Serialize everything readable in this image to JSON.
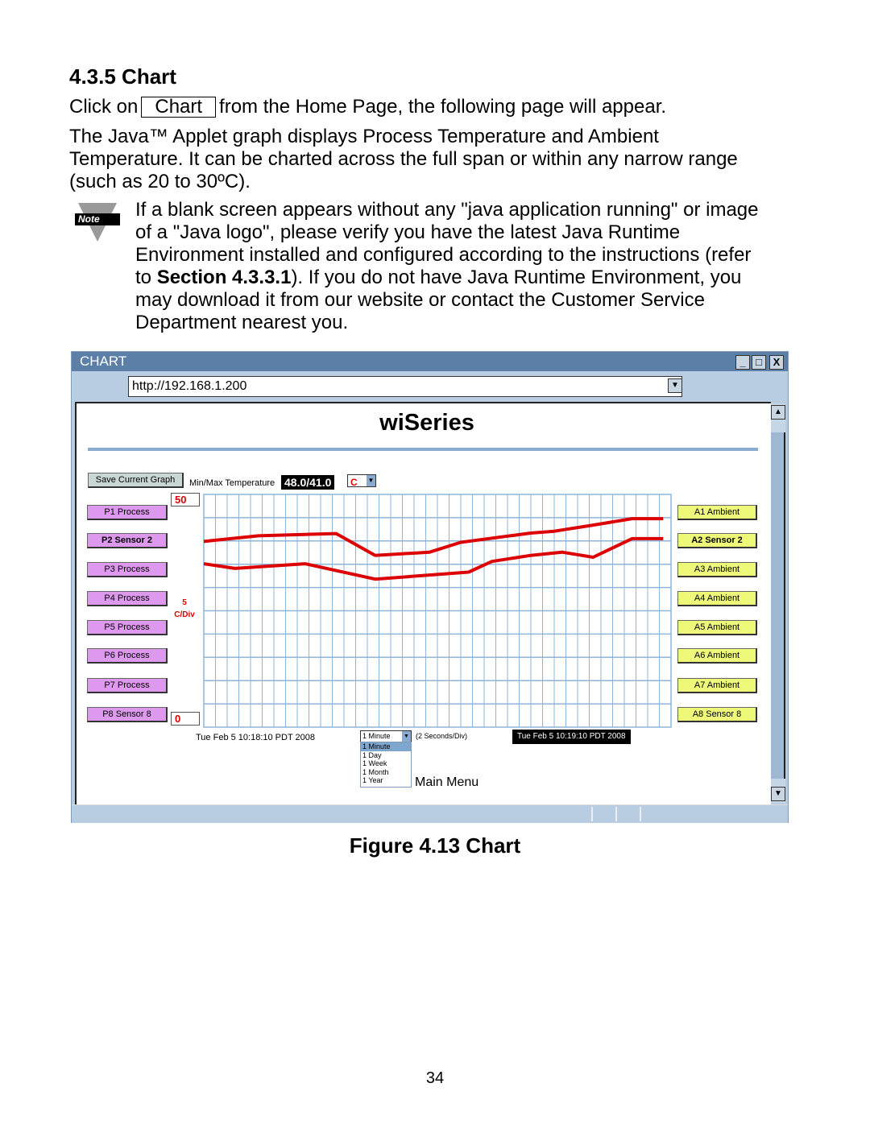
{
  "heading": "4.3.5  Chart",
  "intro": {
    "before": "Click on",
    "button": "Chart",
    "after": "from the Home Page, the following page will appear."
  },
  "para1_lines": [
    "The Java™ Applet graph displays Process Temperature and Ambient",
    "Temperature.  It can be charted across the full span or within any narrow range",
    "(such as 20 to 30ºC)."
  ],
  "note": {
    "icon_label": "Note",
    "lines": [
      "If a blank screen appears without any \"java application running\" or image",
      "of a \"Java logo\", please verify you have the latest Java Runtime",
      "Environment installed and configured according to the instructions (refer"
    ],
    "line4_pre": "to ",
    "line4_bold": "Section 4.3.3.1",
    "line4_post": ").  If you do not have Java Runtime Environment, you",
    "lines_end": [
      "may download it from our website or contact the Customer Service",
      "Department nearest you."
    ]
  },
  "window": {
    "title": "CHART",
    "address": "http://192.168.1.200",
    "controls": [
      "_",
      "□",
      "X"
    ]
  },
  "app": {
    "title": "wiSeries",
    "save_button": "Save Current Graph",
    "minmax_label": "Min/Max Temperature",
    "minmax_value": "48.0/41.0",
    "unit": "C",
    "ymax_input": "50",
    "ymin_input": "0",
    "div_value": "5",
    "div_unit": "C/Div",
    "left_buttons": [
      "P1 Process",
      "P2 Sensor 2",
      "P3 Process",
      "P4 Process",
      "P5 Process",
      "P6 Process",
      "P7 Process",
      "P8 Sensor 8"
    ],
    "right_buttons": [
      "A1 Ambient",
      "A2 Sensor 2",
      "A3 Ambient",
      "A4 Ambient",
      "A5 Ambient",
      "A6 Ambient",
      "A7 Ambient",
      "A8 Sensor 8"
    ],
    "start_time": "Tue Feb 5 10:18:10 PDT 2008",
    "end_time": "Tue Feb 5 10:19:10 PDT 2008",
    "range_select": "1 Minute",
    "range_options": [
      "1 Minute",
      "1 Day",
      "1 Week",
      "1 Month",
      "1 Year"
    ],
    "seconds_div": "(2 Seconds/Div)",
    "main_menu": "Main Menu"
  },
  "colors": {
    "line": "#dd0000",
    "grid": "#8fb6d8",
    "left_button": "#dd99ee",
    "right_button": "#eef97a",
    "titlebar": "#5b7fa6"
  },
  "chart_data": {
    "type": "line",
    "ylim": [
      0,
      50
    ],
    "xlim": [
      "10:18:10",
      "10:19:10"
    ],
    "grid": true,
    "series": [
      {
        "x": [
          "10:18:10",
          "10:18:17",
          "10:18:27",
          "10:18:32",
          "10:18:39",
          "10:18:43",
          "10:18:52",
          "10:18:55",
          "10:19:00",
          "10:19:05",
          "10:19:09"
        ],
        "y": [
          39.9,
          41.1,
          41.6,
          36.9,
          37.6,
          39.7,
          41.7,
          42.1,
          43.4,
          44.8,
          44.8
        ]
      },
      {
        "x": [
          "10:18:10",
          "10:18:14",
          "10:18:23",
          "10:18:32",
          "10:18:44",
          "10:18:47",
          "10:18:52",
          "10:18:56",
          "10:19:00",
          "10:19:05",
          "10:19:09"
        ],
        "y": [
          35.1,
          34.1,
          35.1,
          31.8,
          33.3,
          35.6,
          36.9,
          37.6,
          36.5,
          40.5,
          40.5
        ]
      }
    ]
  },
  "figure_caption": "Figure 4.13  Chart",
  "page_number": "34"
}
